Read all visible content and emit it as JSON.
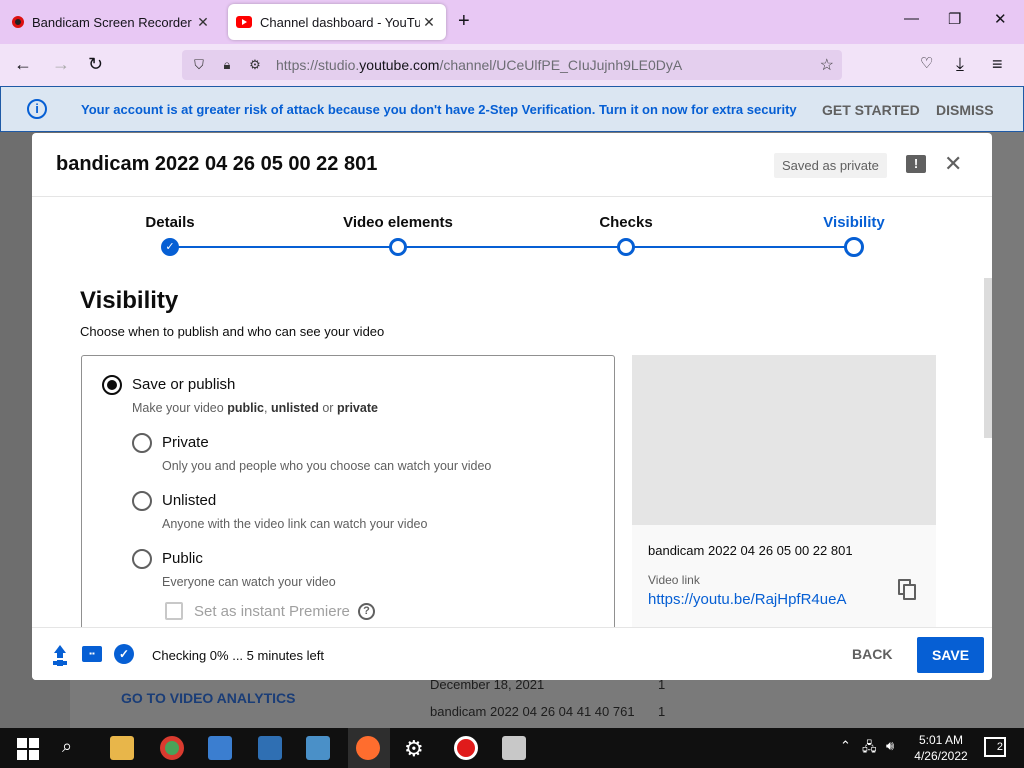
{
  "browser": {
    "tabs": [
      {
        "title": "Bandicam Screen Recorder Dow",
        "active": false
      },
      {
        "title": "Channel dashboard - YouTube S",
        "active": true
      }
    ],
    "new_tab": "+",
    "url_prefix": "https://studio.",
    "url_domain": "youtube.com",
    "url_path": "/channel/UCeUlfPE_CIuJujnh9LE0DyA"
  },
  "banner": {
    "message": "Your account is at greater risk of attack because you don't have 2-Step Verification. Turn it on now for extra security",
    "get_started": "GET STARTED",
    "dismiss": "DISMISS"
  },
  "background": {
    "analytics_link": "GO TO VIDEO ANALYTICS",
    "rows": [
      {
        "title": "December 18, 2021",
        "count": "1"
      },
      {
        "title": "bandicam 2022 04 26 04 41 40 761",
        "count": "1"
      }
    ]
  },
  "modal": {
    "title": "bandicam 2022 04 26 05 00 22 801",
    "saved_status": "Saved as private",
    "steps": [
      {
        "label": "Details",
        "state": "done"
      },
      {
        "label": "Video elements",
        "state": "pending"
      },
      {
        "label": "Checks",
        "state": "pending"
      },
      {
        "label": "Visibility",
        "state": "active"
      }
    ],
    "visibility": {
      "heading": "Visibility",
      "subheading": "Choose when to publish and who can see your video",
      "save_publish_title": "Save or publish",
      "save_publish_desc_prefix": "Make your video ",
      "save_publish_desc_public": "public",
      "save_publish_desc_sep": ", ",
      "save_publish_desc_unlisted": "unlisted",
      "save_publish_desc_or": " or ",
      "save_publish_desc_private": "private",
      "options": [
        {
          "label": "Private",
          "desc": "Only you and people who you choose can watch your video"
        },
        {
          "label": "Unlisted",
          "desc": "Anyone with the video link can watch your video"
        },
        {
          "label": "Public",
          "desc": "Everyone can watch your video"
        }
      ],
      "premiere_label": "Set as instant Premiere"
    },
    "preview": {
      "video_title": "bandicam 2022 04 26 05 00 22 801",
      "link_label": "Video link",
      "link_url": "https://youtu.be/RajHpfR4ueA"
    },
    "footer": {
      "status": "Checking 0% ... 5 minutes left",
      "back": "BACK",
      "save": "SAVE"
    }
  },
  "taskbar": {
    "time": "5:01 AM",
    "date": "4/26/2022",
    "notifications": "2"
  },
  "colors": {
    "accent": "#065fd4",
    "tabbar": "#e8c8f4",
    "banner_bg": "#dbe6f2"
  }
}
